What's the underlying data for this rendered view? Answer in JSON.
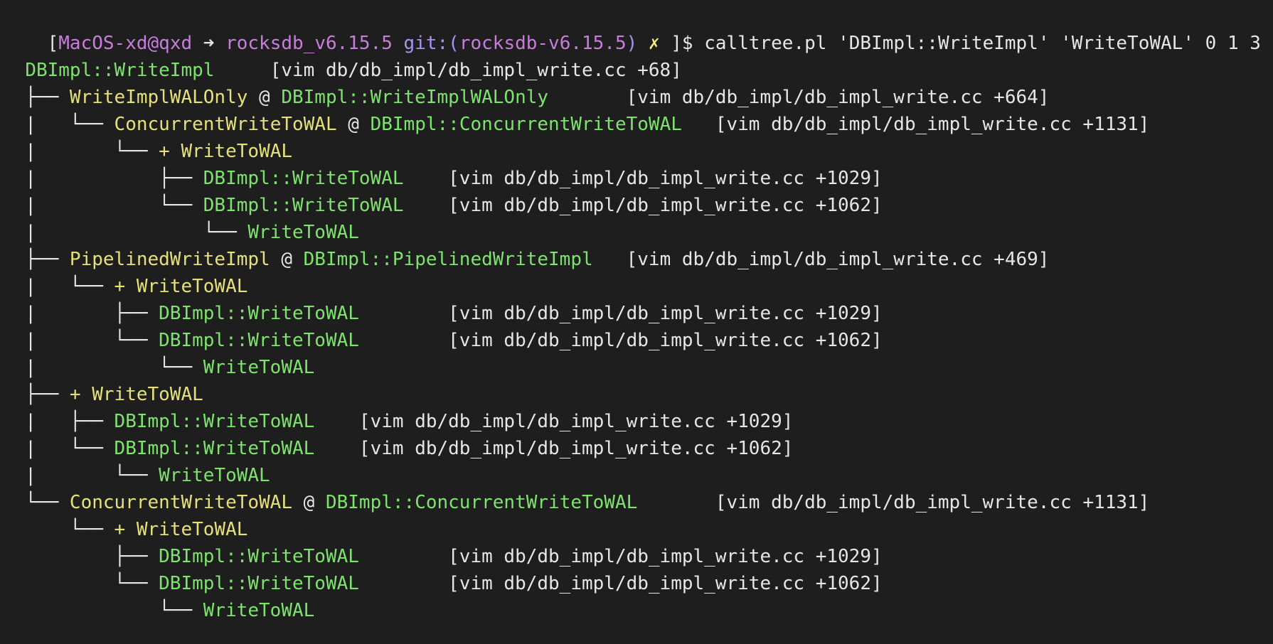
{
  "colors": {
    "background": "#1e1e1e",
    "white": "#e6e6e6",
    "purple": "#c77ddb",
    "violet": "#a993f2",
    "yellow": "#e5e07a",
    "green": "#7ee36d"
  },
  "prompt": {
    "open_bracket": "[",
    "host": "MacOS-xd@qxd",
    "arrow": " ➜ ",
    "directory": "rocksdb_v6.15.5",
    "git_label": " git:(",
    "branch": "rocksdb-v6.15.5",
    "git_close": ")",
    "dirty_mark": " ✗ ",
    "close_bracket": "]$ ",
    "command": "calltree.pl 'DBImpl::WriteImpl' 'WriteToWAL' 0 1 3"
  },
  "tree": [
    [
      {
        "t": "",
        "c": "white"
      }
    ],
    [
      {
        "t": "  ",
        "c": "white"
      },
      {
        "t": "DBImpl::WriteImpl",
        "c": "green"
      },
      {
        "t": "     [vim db/db_impl/db_impl_write.cc +68]",
        "c": "white"
      }
    ],
    [
      {
        "t": "  ├── ",
        "c": "white"
      },
      {
        "t": "WriteImplWALOnly",
        "c": "yellow"
      },
      {
        "t": " @ ",
        "c": "white"
      },
      {
        "t": "DBImpl::WriteImplWALOnly",
        "c": "green"
      },
      {
        "t": "       [vim db/db_impl/db_impl_write.cc +664]",
        "c": "white"
      }
    ],
    [
      {
        "t": "  |   └── ",
        "c": "white"
      },
      {
        "t": "ConcurrentWriteToWAL",
        "c": "yellow"
      },
      {
        "t": " @ ",
        "c": "white"
      },
      {
        "t": "DBImpl::ConcurrentWriteToWAL",
        "c": "green"
      },
      {
        "t": "   [vim db/db_impl/db_impl_write.cc +1131]",
        "c": "white"
      }
    ],
    [
      {
        "t": "  |       └── ",
        "c": "white"
      },
      {
        "t": "+ WriteToWAL",
        "c": "yellow"
      }
    ],
    [
      {
        "t": "  |           ├── ",
        "c": "white"
      },
      {
        "t": "DBImpl::WriteToWAL",
        "c": "green"
      },
      {
        "t": "    [vim db/db_impl/db_impl_write.cc +1029]",
        "c": "white"
      }
    ],
    [
      {
        "t": "  |           └── ",
        "c": "white"
      },
      {
        "t": "DBImpl::WriteToWAL",
        "c": "green"
      },
      {
        "t": "    [vim db/db_impl/db_impl_write.cc +1062]",
        "c": "white"
      }
    ],
    [
      {
        "t": "  |               └── ",
        "c": "white"
      },
      {
        "t": "WriteToWAL",
        "c": "green"
      }
    ],
    [
      {
        "t": "  ├── ",
        "c": "white"
      },
      {
        "t": "PipelinedWriteImpl",
        "c": "yellow"
      },
      {
        "t": " @ ",
        "c": "white"
      },
      {
        "t": "DBImpl::PipelinedWriteImpl",
        "c": "green"
      },
      {
        "t": "   [vim db/db_impl/db_impl_write.cc +469]",
        "c": "white"
      }
    ],
    [
      {
        "t": "  |   └── ",
        "c": "white"
      },
      {
        "t": "+ WriteToWAL",
        "c": "yellow"
      }
    ],
    [
      {
        "t": "  |       ├── ",
        "c": "white"
      },
      {
        "t": "DBImpl::WriteToWAL",
        "c": "green"
      },
      {
        "t": "        [vim db/db_impl/db_impl_write.cc +1029]",
        "c": "white"
      }
    ],
    [
      {
        "t": "  |       └── ",
        "c": "white"
      },
      {
        "t": "DBImpl::WriteToWAL",
        "c": "green"
      },
      {
        "t": "        [vim db/db_impl/db_impl_write.cc +1062]",
        "c": "white"
      }
    ],
    [
      {
        "t": "  |           └── ",
        "c": "white"
      },
      {
        "t": "WriteToWAL",
        "c": "green"
      }
    ],
    [
      {
        "t": "  ├── ",
        "c": "white"
      },
      {
        "t": "+ WriteToWAL",
        "c": "yellow"
      }
    ],
    [
      {
        "t": "  |   ├── ",
        "c": "white"
      },
      {
        "t": "DBImpl::WriteToWAL",
        "c": "green"
      },
      {
        "t": "    [vim db/db_impl/db_impl_write.cc +1029]",
        "c": "white"
      }
    ],
    [
      {
        "t": "  |   └── ",
        "c": "white"
      },
      {
        "t": "DBImpl::WriteToWAL",
        "c": "green"
      },
      {
        "t": "    [vim db/db_impl/db_impl_write.cc +1062]",
        "c": "white"
      }
    ],
    [
      {
        "t": "  |       └── ",
        "c": "white"
      },
      {
        "t": "WriteToWAL",
        "c": "green"
      }
    ],
    [
      {
        "t": "  └── ",
        "c": "white"
      },
      {
        "t": "ConcurrentWriteToWAL",
        "c": "yellow"
      },
      {
        "t": " @ ",
        "c": "white"
      },
      {
        "t": "DBImpl::ConcurrentWriteToWAL",
        "c": "green"
      },
      {
        "t": "       [vim db/db_impl/db_impl_write.cc +1131]",
        "c": "white"
      }
    ],
    [
      {
        "t": "      └── ",
        "c": "white"
      },
      {
        "t": "+ WriteToWAL",
        "c": "yellow"
      }
    ],
    [
      {
        "t": "          ├── ",
        "c": "white"
      },
      {
        "t": "DBImpl::WriteToWAL",
        "c": "green"
      },
      {
        "t": "        [vim db/db_impl/db_impl_write.cc +1029]",
        "c": "white"
      }
    ],
    [
      {
        "t": "          └── ",
        "c": "white"
      },
      {
        "t": "DBImpl::WriteToWAL",
        "c": "green"
      },
      {
        "t": "        [vim db/db_impl/db_impl_write.cc +1062]",
        "c": "white"
      }
    ],
    [
      {
        "t": "              └── ",
        "c": "white"
      },
      {
        "t": "WriteToWAL",
        "c": "green"
      }
    ]
  ]
}
